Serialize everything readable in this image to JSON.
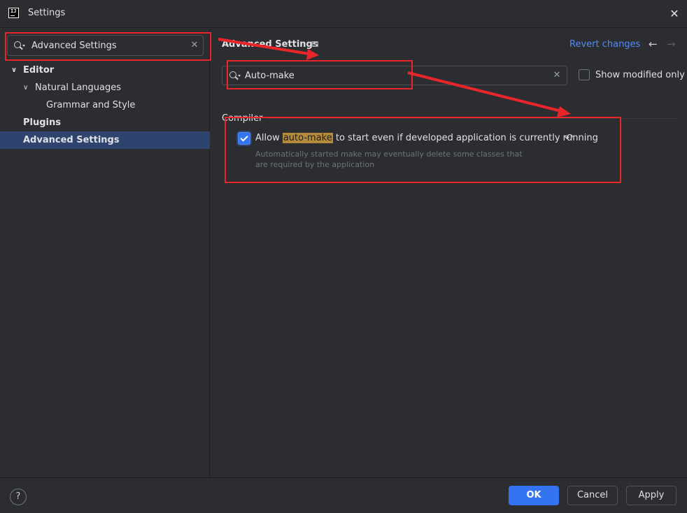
{
  "window": {
    "title": "Settings"
  },
  "sidebar": {
    "search": {
      "value": "Advanced Settings"
    },
    "items": [
      {
        "label": "Editor"
      },
      {
        "label": "Natural Languages"
      },
      {
        "label": "Grammar and Style"
      },
      {
        "label": "Plugins"
      },
      {
        "label": "Advanced Settings"
      }
    ]
  },
  "main": {
    "title": "Advanced Settings",
    "revert_label": "Revert changes",
    "search": {
      "value": "Auto-make"
    },
    "show_modified_label": "Show modified only",
    "show_modified_checked": false,
    "group": "Compiler",
    "option": {
      "checked": true,
      "label_prefix": "Allow ",
      "label_highlight": "auto-make",
      "label_suffix": " to start even if developed application is currently running",
      "description": "Automatically started make may eventually delete some classes that are required by the application"
    }
  },
  "footer": {
    "help_label": "?",
    "ok_label": "OK",
    "cancel_label": "Cancel",
    "apply_label": "Apply"
  },
  "icons": [
    "app-logo-icon",
    "close-icon",
    "search-icon",
    "clear-icon",
    "chevron-down-icon",
    "pin-icon",
    "arrow-left-icon",
    "arrow-right-icon",
    "undo-icon",
    "help-icon"
  ],
  "colors": {
    "background": "#2b2d30",
    "selection": "#2e436e",
    "accent": "#3574f0",
    "link": "#548af7",
    "highlight": "#b48a3c",
    "annotation": "#e8262a"
  }
}
